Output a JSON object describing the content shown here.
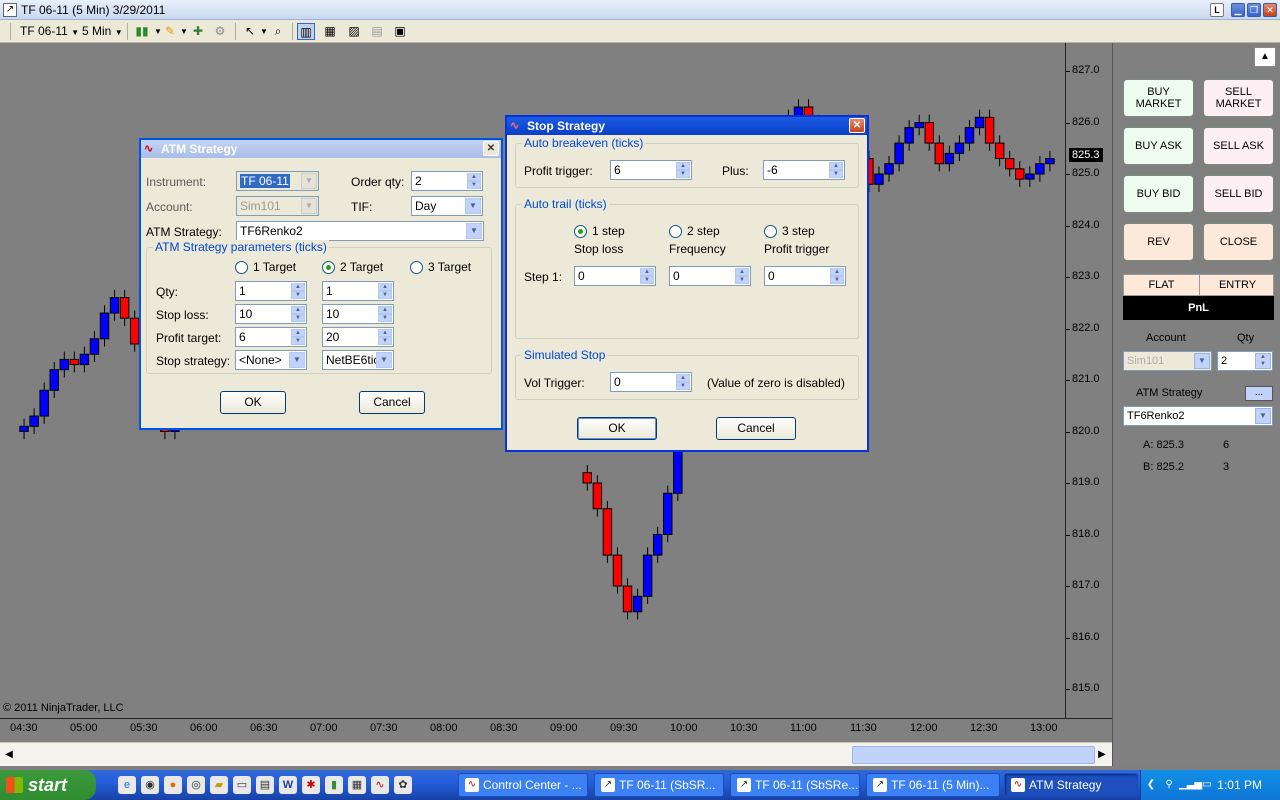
{
  "window": {
    "title": "TF 06-11 (5 Min)  3/29/2011"
  },
  "toolbar": {
    "instrument": "TF 06-11",
    "interval": "5 Min"
  },
  "chart_data": {
    "type": "candlestick",
    "price_axis": {
      "labels": [
        "827.0",
        "826.0",
        "825.0",
        "824.0",
        "823.0",
        "822.0",
        "821.0",
        "820.0",
        "819.0",
        "818.0",
        "817.0",
        "816.0",
        "815.0"
      ],
      "min": 815.0,
      "max": 827.0
    },
    "current_price": "825.3",
    "time_axis": {
      "labels": [
        "04:30",
        "05:00",
        "05:30",
        "06:00",
        "06:30",
        "07:00",
        "07:30",
        "08:00",
        "08:30",
        "09:00",
        "09:30",
        "10:00",
        "10:30",
        "11:00",
        "11:30",
        "12:00",
        "12:30",
        "13:00"
      ]
    },
    "colors": {
      "up": "#0000ff",
      "down": "#ff0000"
    }
  },
  "copyright": "© 2011 NinjaTrader, LLC",
  "panel": {
    "buy_market": "BUY MARKET",
    "sell_market": "SELL MARKET",
    "buy_ask": "BUY ASK",
    "sell_ask": "SELL ASK",
    "buy_bid": "BUY BID",
    "sell_bid": "SELL BID",
    "rev": "REV",
    "close": "CLOSE",
    "flat": "FLAT",
    "entry": "ENTRY",
    "pnl": "PnL",
    "account_label": "Account",
    "qty_label": "Qty",
    "account_value": "Sim101",
    "qty_value": "2",
    "atm_label": "ATM Strategy",
    "atm_dots": "...",
    "atm_value": "TF6Renko2",
    "ask": {
      "label": "A: 825.3",
      "size": "6"
    },
    "bid": {
      "label": "B: 825.2",
      "size": "3"
    }
  },
  "atm_dialog": {
    "title": "ATM Strategy",
    "instrument_label": "Instrument:",
    "instrument_value": "TF 06-11",
    "account_label": "Account:",
    "account_value": "Sim101",
    "order_qty_label": "Order qty:",
    "order_qty_value": "2",
    "tif_label": "TIF:",
    "tif_value": "Day",
    "atm_strategy_label": "ATM Strategy:",
    "atm_strategy_value": "TF6Renko2",
    "params_title": "ATM Strategy parameters (ticks)",
    "target1": "1 Target",
    "target2": "2 Target",
    "target3": "3 Target",
    "qty_label": "Qty:",
    "stop_loss_label": "Stop loss:",
    "profit_target_label": "Profit target:",
    "stop_strategy_label": "Stop strategy:",
    "col1": {
      "qty": "1",
      "stop_loss": "10",
      "profit_target": "6",
      "stop_strategy": "<None>"
    },
    "col2": {
      "qty": "1",
      "stop_loss": "10",
      "profit_target": "20",
      "stop_strategy": "NetBE6tic"
    },
    "ok": "OK",
    "cancel": "Cancel"
  },
  "stop_dialog": {
    "title": "Stop Strategy",
    "auto_breakeven_title": "Auto breakeven (ticks)",
    "profit_trigger_label": "Profit trigger:",
    "profit_trigger_value": "6",
    "plus_label": "Plus:",
    "plus_value": "-6",
    "auto_trail_title": "Auto trail (ticks)",
    "step1_opt": "1 step",
    "step2_opt": "2 step",
    "step3_opt": "3 step",
    "col_stop_loss": "Stop loss",
    "col_frequency": "Frequency",
    "col_profit_trigger": "Profit trigger",
    "step1_label": "Step 1:",
    "step1_values": [
      "0",
      "0",
      "0"
    ],
    "simulated_stop_title": "Simulated Stop",
    "vol_trigger_label": "Vol Trigger:",
    "vol_trigger_value": "0",
    "vol_note": "(Value of zero is disabled)",
    "ok": "OK",
    "cancel": "Cancel"
  },
  "taskbar": {
    "start": "start",
    "tasks": [
      "Control Center - ...",
      "TF 06-11 (SbSR...",
      "TF 06-11 (SbSRe...",
      "TF 06-11 (5 Min)...",
      "ATM Strategy"
    ],
    "clock": "1:01 PM"
  }
}
